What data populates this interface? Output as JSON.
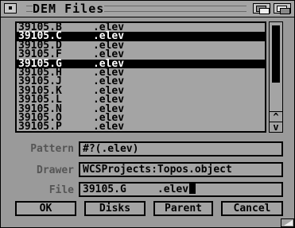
{
  "window": {
    "title": "DEM Files"
  },
  "file_list": {
    "items": [
      {
        "name": "39105.B",
        "ext": ".elev",
        "selected": false
      },
      {
        "name": "39105.C",
        "ext": ".elev",
        "selected": true
      },
      {
        "name": "39105.D",
        "ext": ".elev",
        "selected": false
      },
      {
        "name": "39105.F",
        "ext": ".elev",
        "selected": false
      },
      {
        "name": "39105.G",
        "ext": ".elev",
        "selected": true
      },
      {
        "name": "39105.H",
        "ext": ".elev",
        "selected": false
      },
      {
        "name": "39105.J",
        "ext": ".elev",
        "selected": false
      },
      {
        "name": "39105.K",
        "ext": ".elev",
        "selected": false
      },
      {
        "name": "39105.L",
        "ext": ".elev",
        "selected": false
      },
      {
        "name": "39105.N",
        "ext": ".elev",
        "selected": false
      },
      {
        "name": "39105.O",
        "ext": ".elev",
        "selected": false
      },
      {
        "name": "39105.P",
        "ext": ".elev",
        "selected": false
      }
    ]
  },
  "scroll": {
    "up_arrow": "^",
    "down_arrow": "v"
  },
  "fields": {
    "pattern": {
      "label": "Pattern",
      "value": "#?(.elev)"
    },
    "drawer": {
      "label": "Drawer",
      "value": "WCSProjects:Topos.object"
    },
    "file": {
      "label": "File",
      "value": "39105.G     .elev"
    }
  },
  "buttons": {
    "ok": "OK",
    "disks": "Disks",
    "parent": "Parent",
    "cancel": "Cancel"
  },
  "colors": {
    "background": "#9a9a9a",
    "selection": "#000000",
    "selection_text": "#ffffff"
  }
}
